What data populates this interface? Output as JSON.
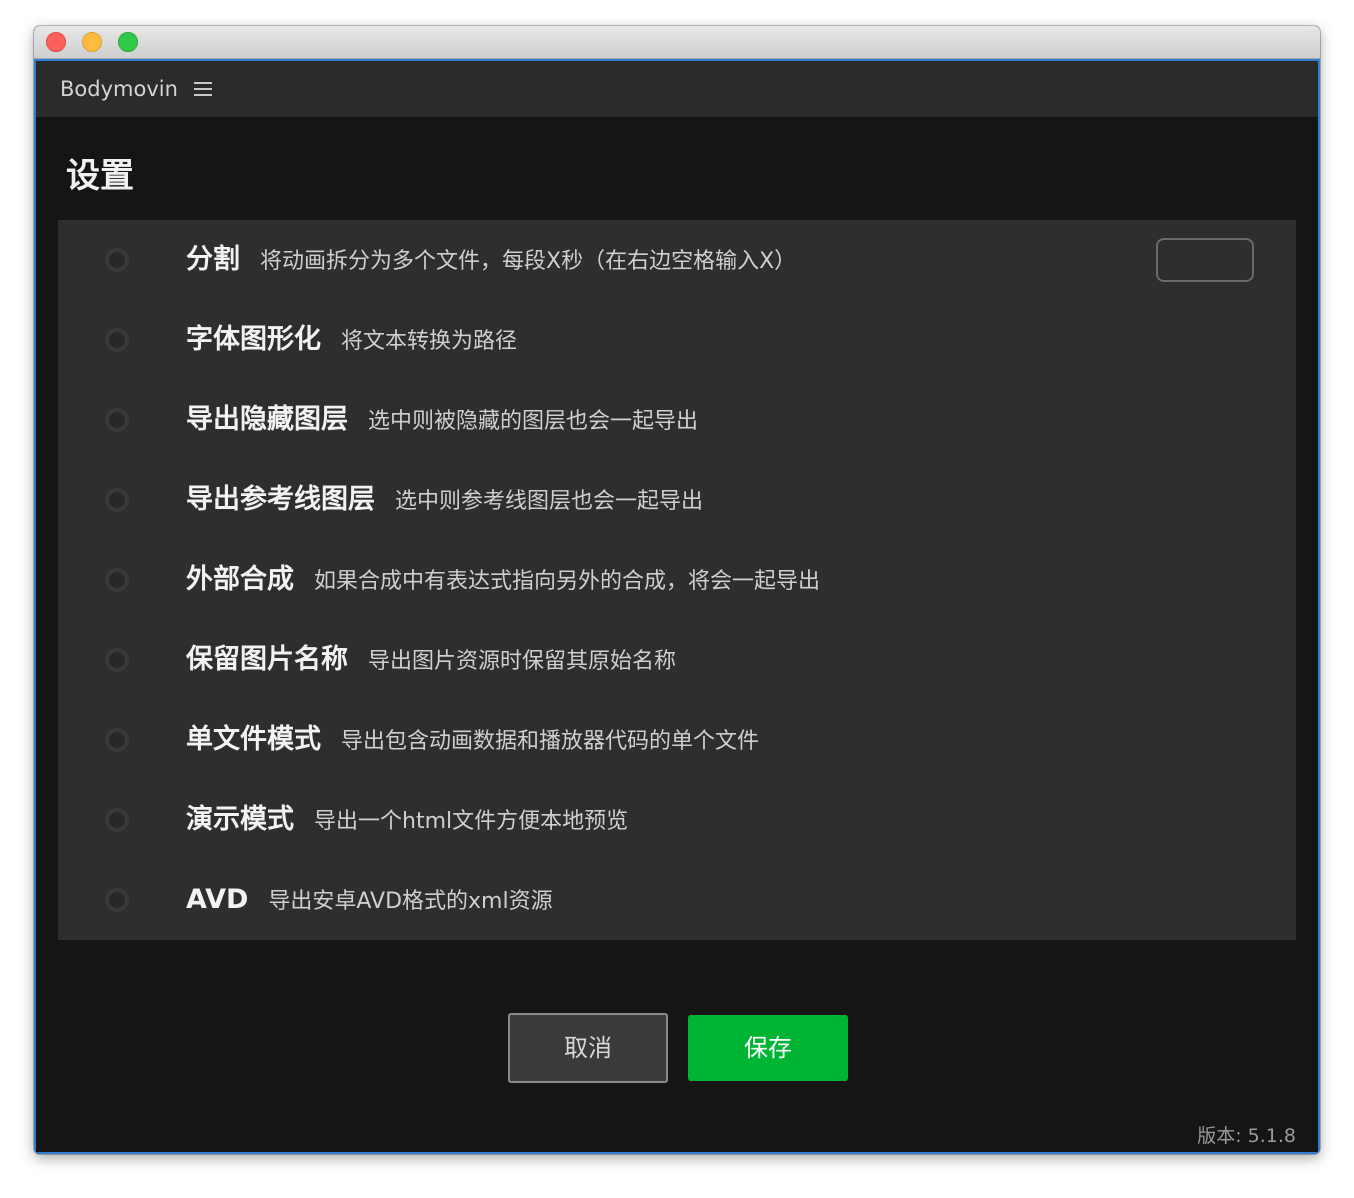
{
  "app": {
    "title": "Bodymovin",
    "menu_icon": "hamburger-menu-icon"
  },
  "page": {
    "title": "设置"
  },
  "settings": [
    {
      "label": "分割",
      "desc": "将动画拆分为多个文件，每段X秒（在右边空格输入X）",
      "checked": false,
      "has_input": true,
      "input_value": ""
    },
    {
      "label": "字体图形化",
      "desc": "将文本转换为路径",
      "checked": false
    },
    {
      "label": "导出隐藏图层",
      "desc": "选中则被隐藏的图层也会一起导出",
      "checked": false
    },
    {
      "label": "导出参考线图层",
      "desc": "选中则参考线图层也会一起导出",
      "checked": false
    },
    {
      "label": "外部合成",
      "desc": "如果合成中有表达式指向另外的合成，将会一起导出",
      "checked": false
    },
    {
      "label": "保留图片名称",
      "desc": "导出图片资源时保留其原始名称",
      "checked": false
    },
    {
      "label": "单文件模式",
      "desc": "导出包含动画数据和播放器代码的单个文件",
      "checked": false
    },
    {
      "label": "演示模式",
      "desc": "导出一个html文件方便本地预览",
      "checked": false
    },
    {
      "label": "AVD",
      "desc": "导出安卓AVD格式的xml资源",
      "checked": false
    }
  ],
  "buttons": {
    "cancel": "取消",
    "save": "保存"
  },
  "footer": {
    "version": "版本: 5.1.8"
  },
  "colors": {
    "accent_green": "#00b533",
    "window_border": "#2f7fd8",
    "background": "#151515",
    "list_background": "#2e2e2e"
  }
}
